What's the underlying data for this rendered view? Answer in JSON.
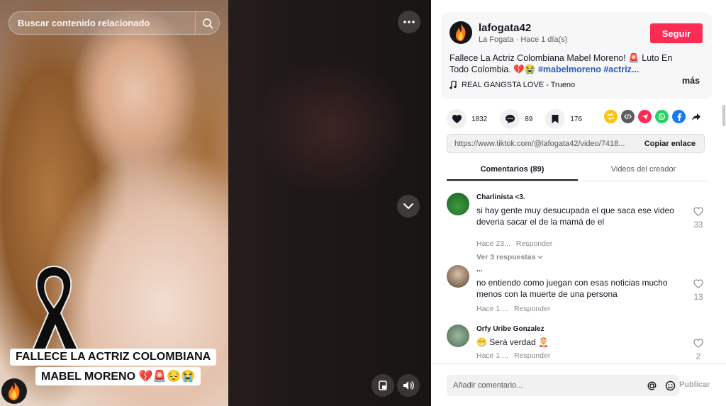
{
  "search": {
    "placeholder": "Buscar contenido relacionado"
  },
  "video": {
    "caption_line1": "FALLECE LA ACTRIZ COLOMBIANA",
    "caption_line2": "MABEL MORENO 💔🚨😔😭"
  },
  "author": {
    "username": "lafogata42",
    "display_name": "La Fogata",
    "posted": "Hace 1 día(s)",
    "follow_label": "Seguir"
  },
  "post": {
    "description_text": "Fallece La Actriz Colombiana Mabel Moreno! 🚨 Luto En Todo Colombia. 💔😭 ",
    "hashtags": "#mabelmoreno #actriz...",
    "more_label": "más",
    "music": "REAL GANGSTA LOVE - Trueno"
  },
  "stats": {
    "likes": "1832",
    "comments": "89",
    "saves": "176"
  },
  "share": {
    "url": "https://www.tiktok.com/@lafogata42/video/7418...",
    "copy_label": "Copiar enlace"
  },
  "tabs": [
    {
      "label": "Comentarios (89)",
      "active": true
    },
    {
      "label": "Videos del creador",
      "active": false
    }
  ],
  "comments": [
    {
      "user": "Charlinista <3.",
      "text": "si hay gente muy desucupada el que saca ese video deveria sacar el de la mamá de el",
      "time": "Hace 23...",
      "reply_label": "Responder",
      "likes": "33",
      "replies_label": "Ver 3 respuestas"
    },
    {
      "user": "...",
      "text": "no entiendo como juegan con esas noticias mucho menos con la muerte de una persona",
      "time": "Hace 1 ...",
      "reply_label": "Responder",
      "likes": "13"
    },
    {
      "user": "Orfy Uribe Gonzalez",
      "text": "😁  Será verdad 🤶",
      "time": "Hace 1 ...",
      "reply_label": "Responder",
      "likes": "2"
    }
  ],
  "composer": {
    "placeholder": "Añadir comentario...",
    "publish_label": "Publicar"
  },
  "colors": {
    "follow": "#fe2c55",
    "hashtag": "#2b5db9"
  }
}
